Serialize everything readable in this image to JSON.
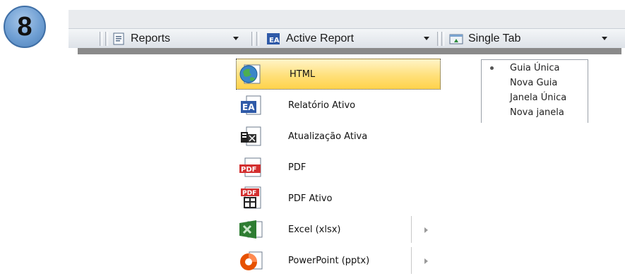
{
  "step_number": "8",
  "toolbar": {
    "reports_label": "Reports",
    "active_report_label": "Active Report",
    "single_tab_label": "Single Tab"
  },
  "format_menu": {
    "items": [
      {
        "label": "HTML",
        "icon": "globe-icon",
        "selected": true
      },
      {
        "label": "Relatório Ativo",
        "icon": "active-report-icon"
      },
      {
        "label": "Atualização Ativa",
        "icon": "active-update-icon"
      },
      {
        "label": "PDF",
        "icon": "pdf-icon"
      },
      {
        "label": "PDF Ativo",
        "icon": "active-pdf-icon"
      },
      {
        "label": "Excel (xlsx)",
        "icon": "excel-icon",
        "has_submenu": true
      },
      {
        "label": "PowerPoint (pptx)",
        "icon": "powerpoint-icon",
        "has_submenu": true
      }
    ]
  },
  "target_menu": {
    "items": [
      {
        "label": "Guia Única",
        "selected": true
      },
      {
        "label": "Nova Guia"
      },
      {
        "label": "Janela Única"
      },
      {
        "label": "Nova janela"
      }
    ]
  },
  "colors": {
    "selected_highlight": "#ffd24a",
    "badge_blue": "#6f9fd3",
    "toolbar_bg": "#dde2e8"
  }
}
